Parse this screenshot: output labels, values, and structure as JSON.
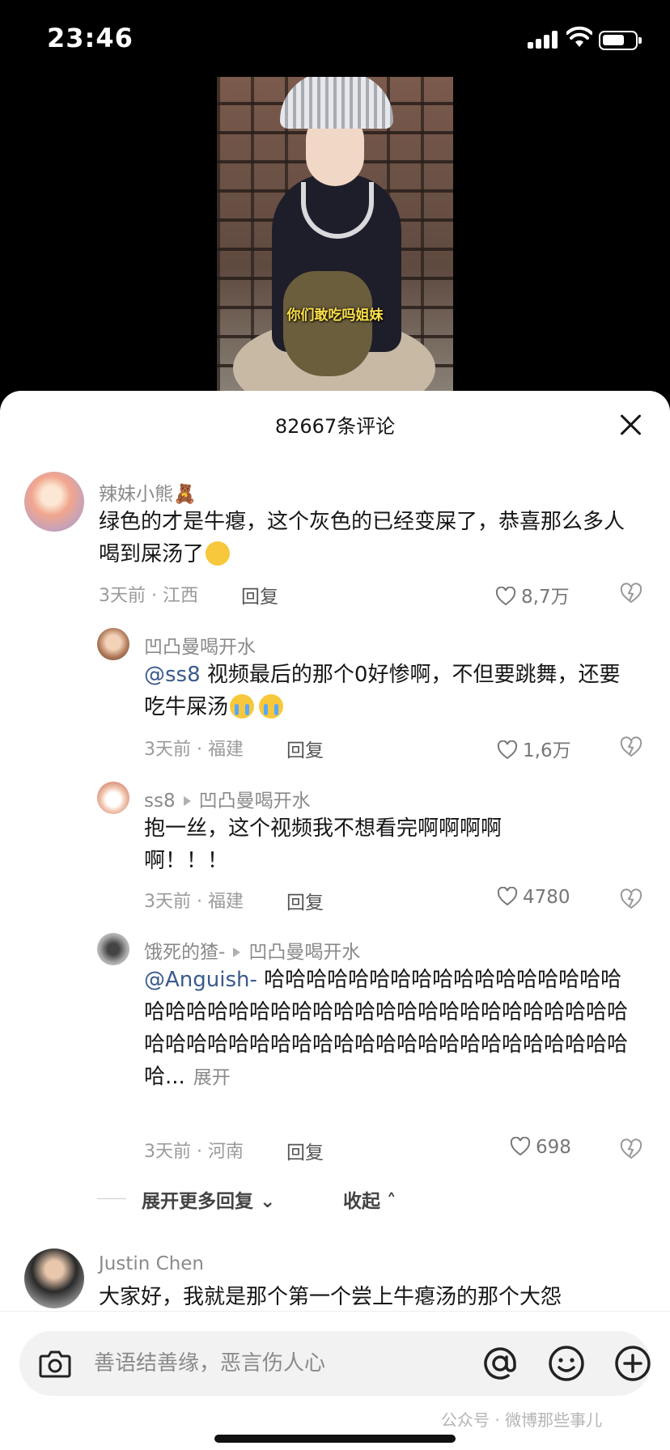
{
  "status_bar": {
    "time": "23:46"
  },
  "video": {
    "caption": "你们敢吃吗姐妹"
  },
  "sheet": {
    "title": "82667条评论"
  },
  "comments": [
    {
      "username": "辣妹小熊🧸",
      "text": "绿色的才是牛瘪，这个灰色的已经变屎了，恭喜那么多人喝到屎汤了",
      "time_loc": "3天前 · 江西",
      "reply": "回复",
      "likes": "8,7万"
    },
    {
      "username": "凹凸曼喝开水",
      "mention": "@ss8",
      "text": " 视频最后的那个0好惨啊，不但要跳舞，还要吃牛屎汤",
      "time_loc": "3天前 · 福建",
      "reply": "回复",
      "likes": "1,6万"
    },
    {
      "username": "ss8",
      "reply_to": "凹凸曼喝开水",
      "text": "抱一丝，这个视频我不想看完啊啊啊啊啊！！！",
      "time_loc": "3天前 · 福建",
      "reply": "回复",
      "likes": "4780"
    },
    {
      "username": "饿死的猹-",
      "reply_to": "凹凸曼喝开水",
      "mention": "@Anguish-",
      "text": " 哈哈哈哈哈哈哈哈哈哈哈哈哈哈哈哈哈哈哈哈哈哈哈哈哈哈哈哈哈哈哈哈哈哈哈哈哈哈哈哈哈哈哈哈哈哈哈哈哈哈哈哈哈哈哈哈哈哈哈哈哈哈哈哈...",
      "expand": "展开",
      "time_loc": "3天前 · 河南",
      "reply": "回复",
      "likes": "698"
    },
    {
      "username": "Justin Chen",
      "text": "大家好，我就是那个第一个尝上牛瘪汤的那个大怨"
    }
  ],
  "thread_controls": {
    "more_replies": "展开更多回复",
    "collapse": "收起"
  },
  "input": {
    "placeholder": "善语结善缘，恶言伤人心"
  },
  "watermark": "公众号 · 微博那些事儿"
}
